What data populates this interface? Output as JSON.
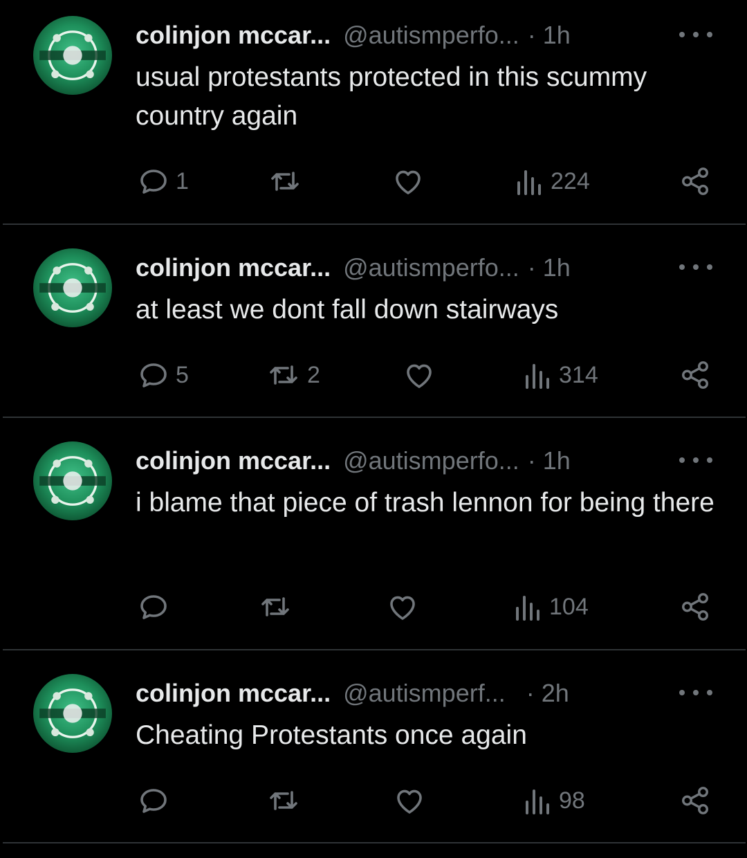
{
  "colors": {
    "background": "#000000",
    "text": "#e7e9ea",
    "muted": "#71767b",
    "divider": "#2f3336"
  },
  "tweets": [
    {
      "name": "colinjon mccar...",
      "handle": "@autismperfo...",
      "separator": "·",
      "time": "1h",
      "text": "usual protestants protected in this scummy country again",
      "replies": "1",
      "retweets": "",
      "likes": "",
      "views": "224"
    },
    {
      "name": "colinjon mccar...",
      "handle": "@autismperfo...",
      "separator": "·",
      "time": "1h",
      "text": "at least we dont fall down stairways",
      "replies": "5",
      "retweets": "2",
      "likes": "",
      "views": "314"
    },
    {
      "name": "colinjon mccar...",
      "handle": "@autismperfo...",
      "separator": "·",
      "time": "1h",
      "text": "i blame that piece of trash lennon for being there",
      "replies": "",
      "retweets": "",
      "likes": "",
      "views": "104"
    },
    {
      "name": "colinjon mccar...",
      "handle": "@autismperf...",
      "separator": "·",
      "time": "2h",
      "text": "Cheating Protestants once again",
      "replies": "",
      "retweets": "",
      "likes": "",
      "views": "98"
    }
  ],
  "icons": {
    "avatar": "team-crest-avatar",
    "more": "more-horizontal-icon",
    "reply": "reply-bubble-icon",
    "retweet": "retweet-icon",
    "like": "heart-icon",
    "views": "views-bar-chart-icon",
    "share": "share-icon"
  }
}
